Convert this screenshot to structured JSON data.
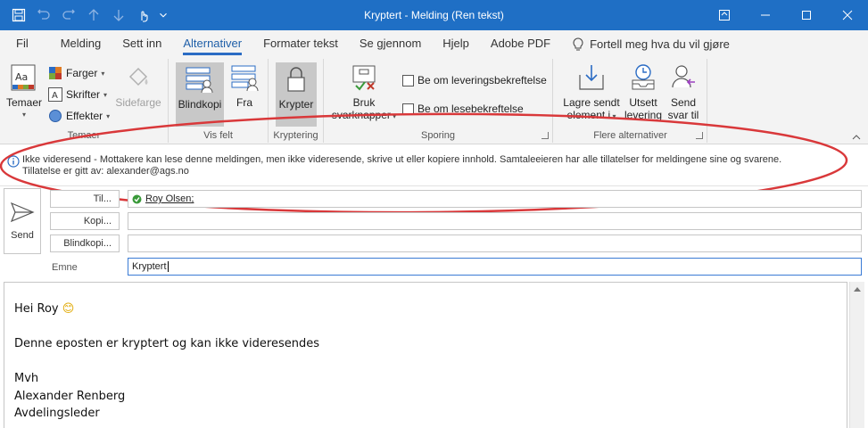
{
  "window": {
    "title": "Kryptert  -  Melding (Ren tekst)"
  },
  "tabs": [
    {
      "label": "Fil"
    },
    {
      "label": "Melding"
    },
    {
      "label": "Sett inn"
    },
    {
      "label": "Alternativer"
    },
    {
      "label": "Formater tekst"
    },
    {
      "label": "Se gjennom"
    },
    {
      "label": "Hjelp"
    },
    {
      "label": "Adobe PDF"
    }
  ],
  "tell_me": "Fortell meg hva du vil gjøre",
  "ribbon": {
    "themes": {
      "label": "Temaer",
      "themes_button": "Temaer",
      "colors": "Farger",
      "fonts": "Skrifter",
      "effects": "Effekter",
      "page_color": "Sidefarge"
    },
    "show_fields": {
      "label": "Vis felt",
      "bcc": "Blindkopi",
      "from": "Fra"
    },
    "encrypt": {
      "label": "Kryptering",
      "encrypt_button": "Krypter"
    },
    "tracking": {
      "label": "Sporing",
      "use_voting": "Bruk",
      "voting_buttons": "svarknapper",
      "delivery_receipt": "Be om leveringsbekreftelse",
      "read_receipt": "Be om lesebekreftelse"
    },
    "more_options": {
      "label": "Flere alternativer",
      "save_sent": "Lagre sendt",
      "save_sent_2": "element i",
      "delay": "Utsett",
      "delay_2": "levering",
      "direct_replies": "Send",
      "direct_replies_2": "svar til"
    }
  },
  "infobar": {
    "line1": "Ikke videresend - Mottakere kan lese denne meldingen, men ikke videresende, skrive ut eller kopiere innhold. Samtaleeieren har alle tillatelser for meldingene sine og svarene.",
    "line2": "Tillatelse er gitt av: alexander@ags.no"
  },
  "header": {
    "send": "Send",
    "to_button": "Til...",
    "cc_button": "Kopi...",
    "bcc_button": "Blindkopi...",
    "subject_label": "Emne",
    "to_value": "Roy Olsen;",
    "cc_value": "",
    "bcc_value": "",
    "subject_value": "Kryptert"
  },
  "body": {
    "greeting": "Hei Roy",
    "emoji": "😊",
    "line1": "Denne eposten er kryptert og kan ikke videresendes",
    "sign1": "Mvh",
    "sign2": "Alexander Renberg",
    "sign3": "Avdelingsleder"
  },
  "colors": {
    "titlebar": "#1f6fc5",
    "accent": "#2b6cc4",
    "annotation": "#d9383a"
  }
}
